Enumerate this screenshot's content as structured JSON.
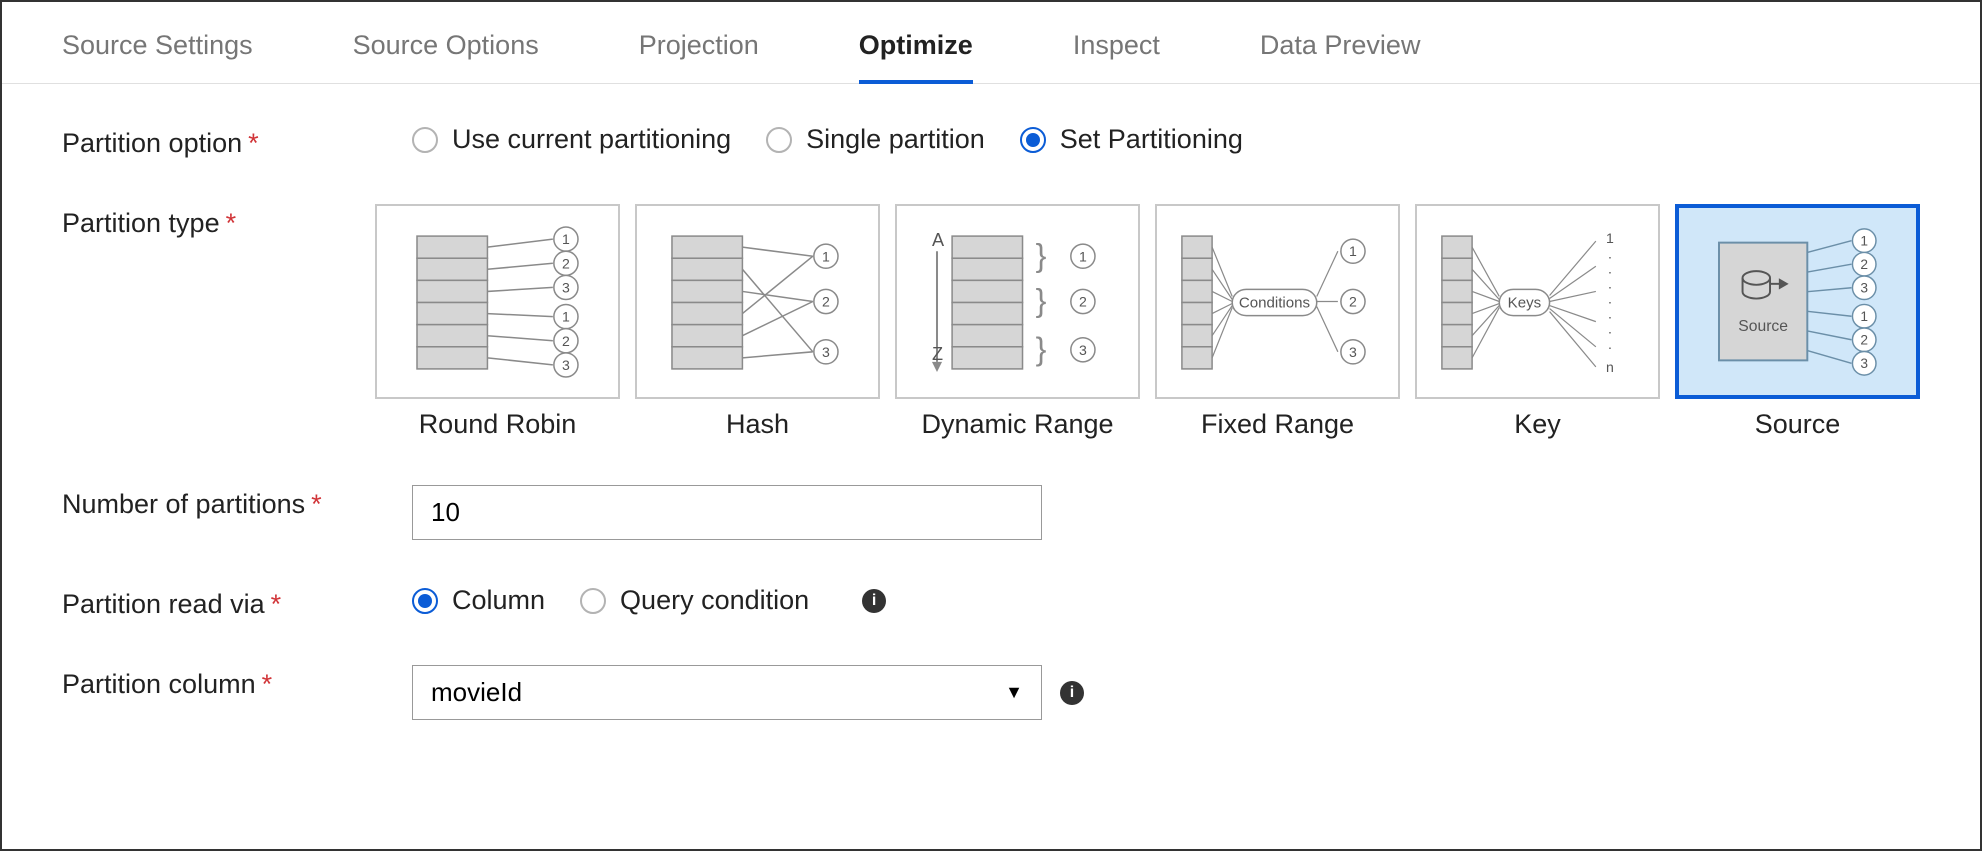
{
  "tabs": [
    "Source Settings",
    "Source Options",
    "Projection",
    "Optimize",
    "Inspect",
    "Data Preview"
  ],
  "activeTab": 3,
  "labels": {
    "partitionOption": "Partition option",
    "partitionType": "Partition type",
    "numberOfPartitions": "Number of partitions",
    "partitionReadVia": "Partition read via",
    "partitionColumn": "Partition column"
  },
  "partitionOptionRadios": [
    {
      "id": "use-current",
      "label": "Use current partitioning",
      "selected": false
    },
    {
      "id": "single",
      "label": "Single partition",
      "selected": false
    },
    {
      "id": "set",
      "label": "Set Partitioning",
      "selected": true
    }
  ],
  "partitionTypes": [
    {
      "id": "round-robin",
      "label": "Round Robin",
      "selected": false
    },
    {
      "id": "hash",
      "label": "Hash",
      "selected": false
    },
    {
      "id": "dynamic-range",
      "label": "Dynamic Range",
      "selected": false
    },
    {
      "id": "fixed-range",
      "label": "Fixed Range",
      "selected": false
    },
    {
      "id": "key",
      "label": "Key",
      "selected": false
    },
    {
      "id": "source",
      "label": "Source",
      "selected": true
    }
  ],
  "partitionTypeInternal": {
    "conditionsLabel": "Conditions",
    "keysLabel": "Keys",
    "sourceLabel": "Source"
  },
  "numberOfPartitions": "10",
  "partitionReadVia": [
    {
      "id": "column",
      "label": "Column",
      "selected": true
    },
    {
      "id": "query",
      "label": "Query condition",
      "selected": false
    }
  ],
  "partitionColumn": "movieId"
}
